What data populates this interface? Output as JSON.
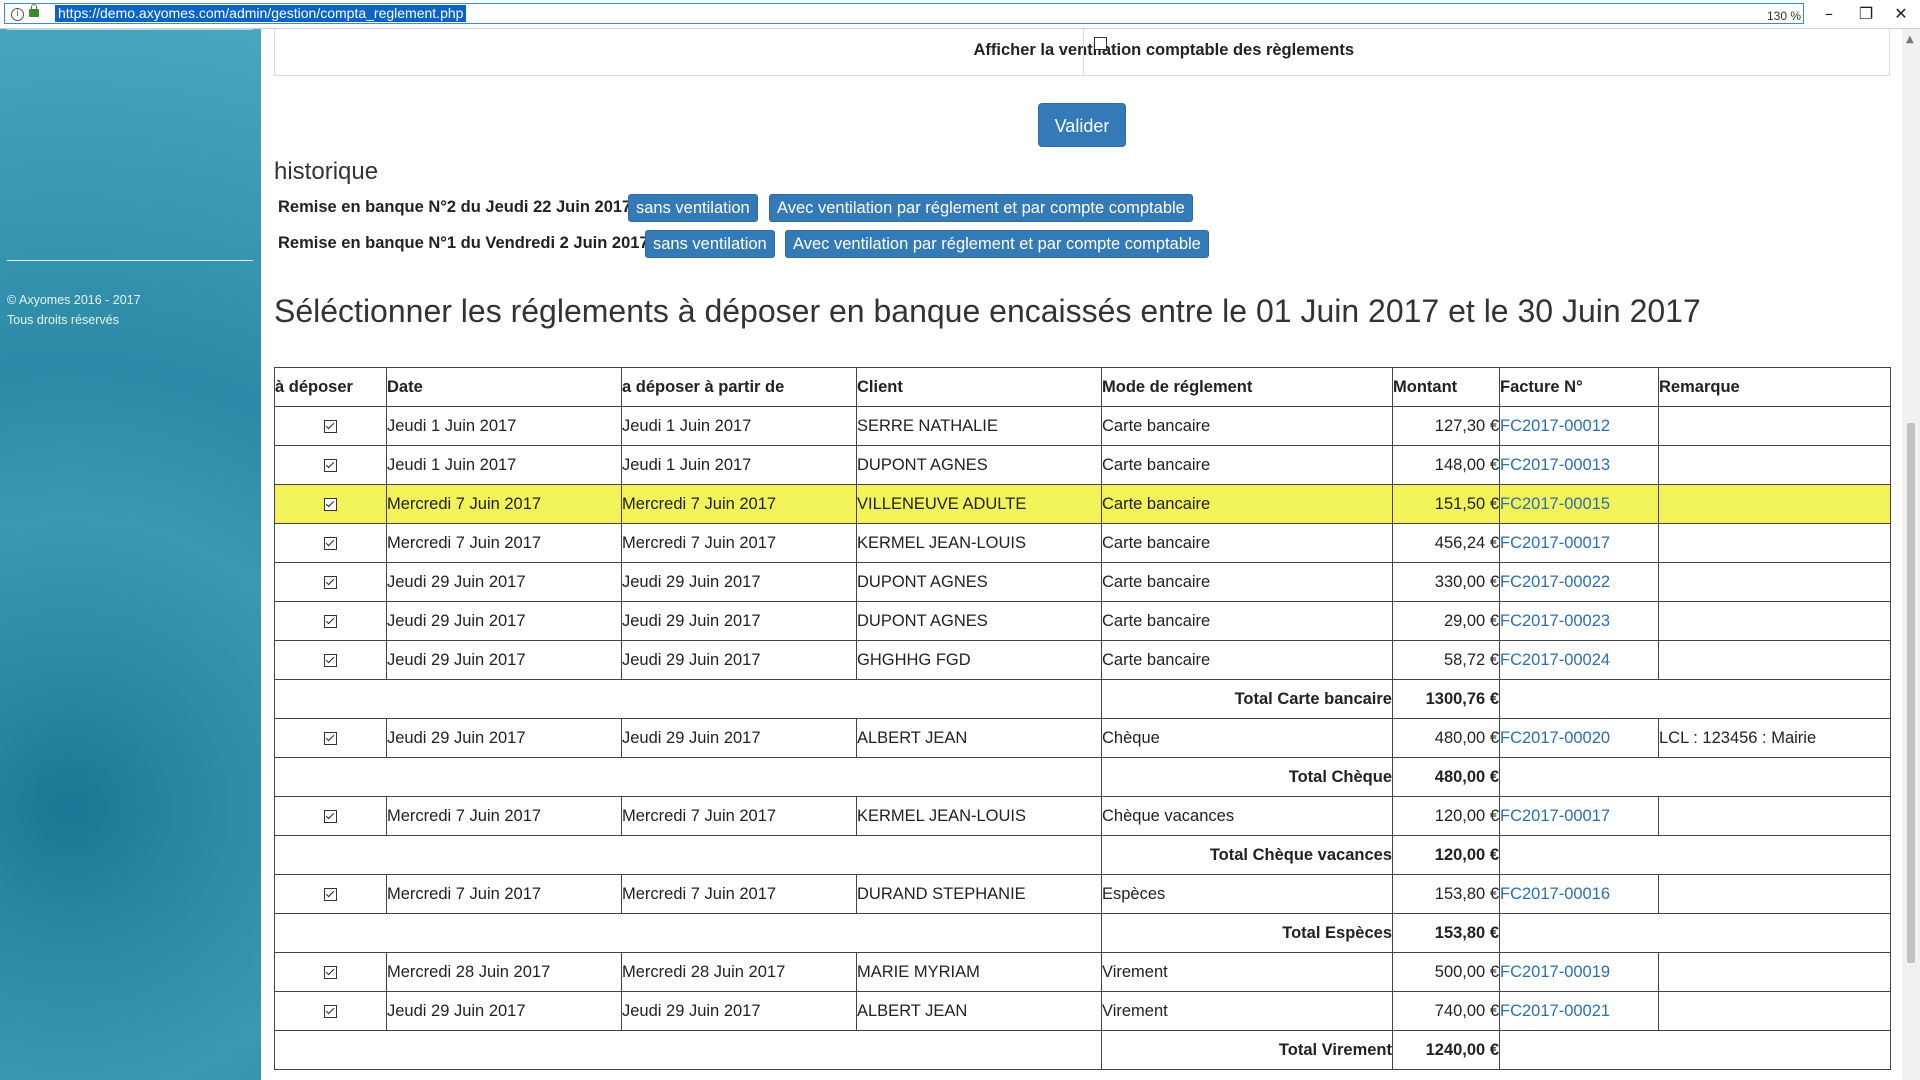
{
  "browser": {
    "url": "https://demo.axyomes.com/admin/gestion/compta_reglement.php",
    "zoom": "130 %",
    "min_glyph": "–",
    "restore_glyph": "❐",
    "close_glyph": "✕"
  },
  "sidebar": {
    "copyright_line1": "© Axyomes 2016 - 2017",
    "copyright_line2": "Tous droits réservés"
  },
  "filter": {
    "label": "Afficher la ventilation comptable des règlements",
    "checked": false
  },
  "valider_label": "Valider",
  "historique": {
    "title": "historique",
    "rows": [
      {
        "label": "Remise en banque N°2 du Jeudi 22 Juin 2017",
        "btn1": "sans ventilation",
        "btn2": "Avec ventilation par réglement et par compte comptable"
      },
      {
        "label": "Remise en banque N°1 du Vendredi 2 Juin 2017",
        "btn1": "sans ventilation",
        "btn2": "Avec ventilation par réglement et par compte comptable"
      }
    ]
  },
  "selection_title": "Séléctionner les réglements à déposer en banque encaissés entre le 01 Juin 2017 et le 30 Juin 2017",
  "table": {
    "headers": {
      "deposer": "à déposer",
      "date": "Date",
      "apartir": "a déposer à partir de",
      "client": "Client",
      "mode": "Mode de réglement",
      "montant": "Montant",
      "facture": "Facture N°",
      "remarque": "Remarque"
    },
    "rows": [
      {
        "date": "Jeudi 1 Juin 2017",
        "apartir": "Jeudi 1 Juin 2017",
        "client": "SERRE NATHALIE",
        "mode": "Carte bancaire",
        "montant": "127,30 €",
        "facture": "FC2017-00012",
        "remarque": ""
      },
      {
        "date": "Jeudi 1 Juin 2017",
        "apartir": "Jeudi 1 Juin 2017",
        "client": "DUPONT AGNES",
        "mode": "Carte bancaire",
        "montant": "148,00 €",
        "facture": "FC2017-00013",
        "remarque": ""
      },
      {
        "date": "Mercredi 7 Juin 2017",
        "apartir": "Mercredi 7 Juin 2017",
        "client": "VILLENEUVE ADULTE",
        "mode": "Carte bancaire",
        "montant": "151,50 €",
        "facture": "FC2017-00015",
        "remarque": ""
      },
      {
        "date": "Mercredi 7 Juin 2017",
        "apartir": "Mercredi 7 Juin 2017",
        "client": "KERMEL JEAN-LOUIS",
        "mode": "Carte bancaire",
        "montant": "456,24 €",
        "facture": "FC2017-00017",
        "remarque": ""
      },
      {
        "date": "Jeudi 29 Juin 2017",
        "apartir": "Jeudi 29 Juin 2017",
        "client": "DUPONT AGNES",
        "mode": "Carte bancaire",
        "montant": "330,00 €",
        "facture": "FC2017-00022",
        "remarque": ""
      },
      {
        "date": "Jeudi 29 Juin 2017",
        "apartir": "Jeudi 29 Juin 2017",
        "client": "DUPONT AGNES",
        "mode": "Carte bancaire",
        "montant": "29,00 €",
        "facture": "FC2017-00023",
        "remarque": ""
      },
      {
        "date": "Jeudi 29 Juin 2017",
        "apartir": "Jeudi 29 Juin 2017",
        "client": "GHGHHG FGD",
        "mode": "Carte bancaire",
        "montant": "58,72 €",
        "facture": "FC2017-00024",
        "remarque": ""
      },
      {
        "date": "Jeudi 29 Juin 2017",
        "apartir": "Jeudi 29 Juin 2017",
        "client": "ALBERT JEAN",
        "mode": "Chèque",
        "montant": "480,00 €",
        "facture": "FC2017-00020",
        "remarque": "LCL : 123456 : Mairie"
      },
      {
        "date": "Mercredi 7 Juin 2017",
        "apartir": "Mercredi 7 Juin 2017",
        "client": "KERMEL JEAN-LOUIS",
        "mode": "Chèque vacances",
        "montant": "120,00 €",
        "facture": "FC2017-00017",
        "remarque": ""
      },
      {
        "date": "Mercredi 7 Juin 2017",
        "apartir": "Mercredi 7 Juin 2017",
        "client": "DURAND STEPHANIE",
        "mode": "Espèces",
        "montant": "153,80 €",
        "facture": "FC2017-00016",
        "remarque": ""
      },
      {
        "date": "Mercredi 28 Juin 2017",
        "apartir": "Mercredi 28 Juin 2017",
        "client": "MARIE MYRIAM",
        "mode": "Virement",
        "montant": "500,00 €",
        "facture": "FC2017-00019",
        "remarque": ""
      },
      {
        "date": "Jeudi 29 Juin 2017",
        "apartir": "Jeudi 29 Juin 2017",
        "client": "ALBERT JEAN",
        "mode": "Virement",
        "montant": "740,00 €",
        "facture": "FC2017-00021",
        "remarque": ""
      }
    ],
    "totals": {
      "carte": {
        "label": "Total Carte bancaire",
        "value": "1300,76 €"
      },
      "cheque": {
        "label": "Total Chèque",
        "value": "480,00 €"
      },
      "vacances": {
        "label": "Total Chèque vacances",
        "value": "120,00 €"
      },
      "especes": {
        "label": "Total Espèces",
        "value": "153,80 €"
      },
      "virement": {
        "label": "Total Virement",
        "value": "1240,00 €"
      }
    },
    "highlight_color": "#f2f259"
  },
  "colors": {
    "primary_button": "#337ab7",
    "link": "#2a6fb5",
    "sidebar": "#2c8aa6"
  }
}
